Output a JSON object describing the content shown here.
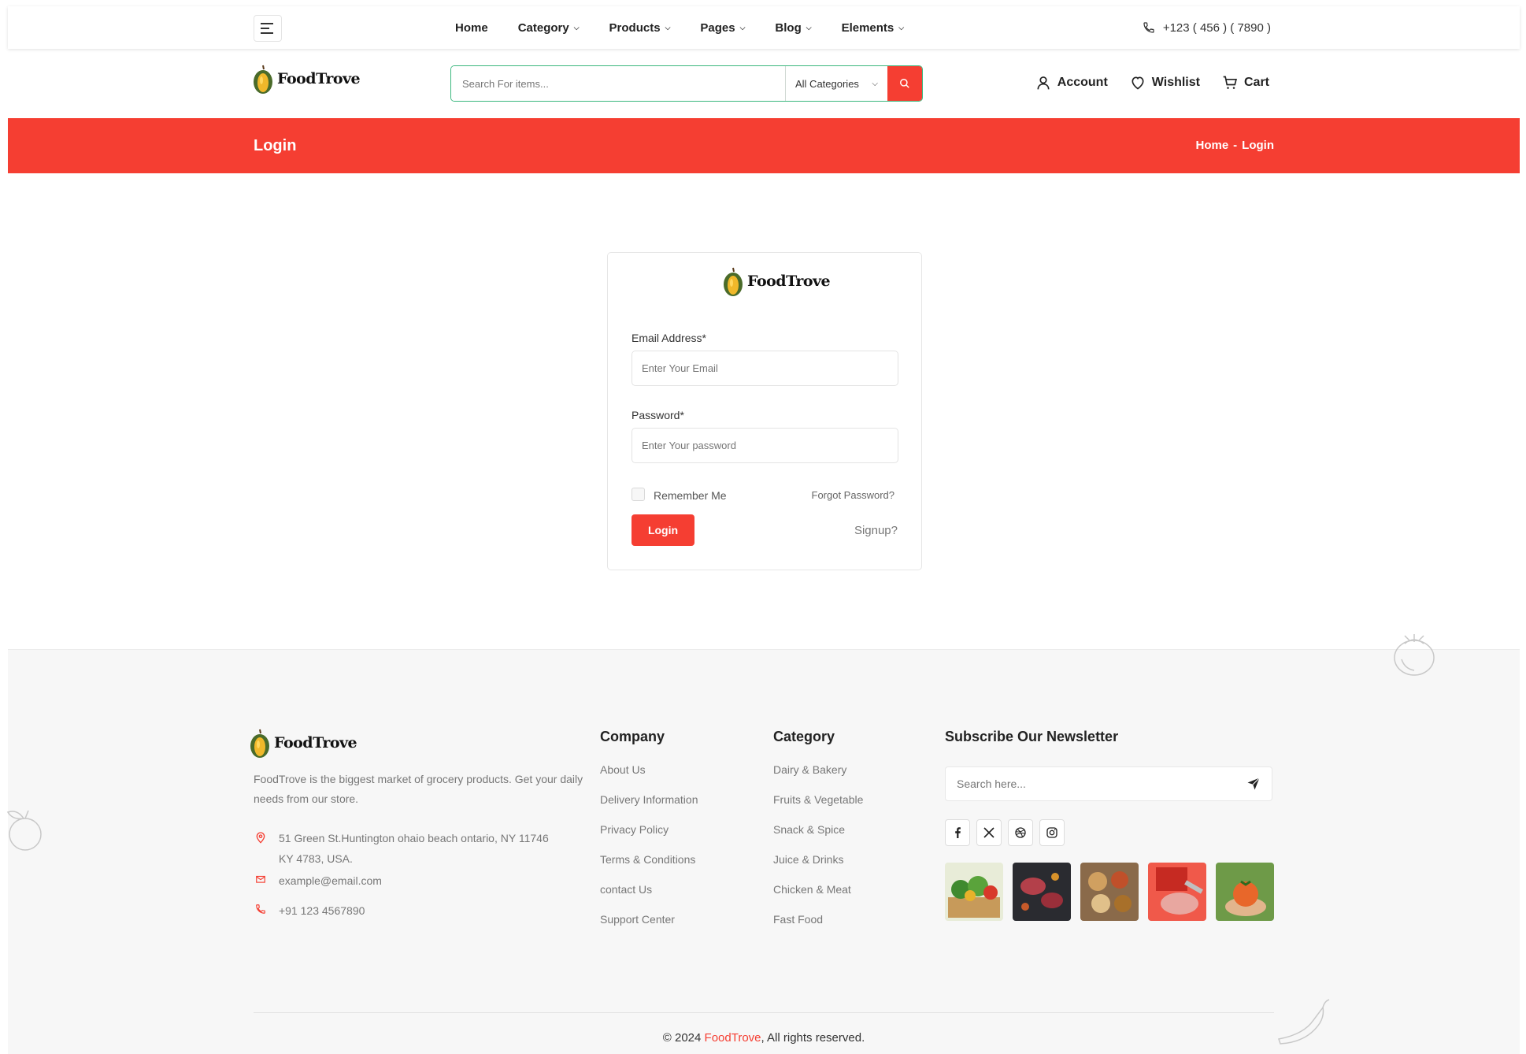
{
  "nav": {
    "links": [
      {
        "label": "Home",
        "dropdown": false
      },
      {
        "label": "Category",
        "dropdown": true
      },
      {
        "label": "Products",
        "dropdown": true
      },
      {
        "label": "Pages",
        "dropdown": true
      },
      {
        "label": "Blog",
        "dropdown": true
      },
      {
        "label": "Elements",
        "dropdown": true
      }
    ],
    "phone": "+123 ( 456 ) ( 7890 )"
  },
  "brand": {
    "name": "FoodTrove"
  },
  "search": {
    "placeholder": "Search For items...",
    "category": "All Categories"
  },
  "header_actions": {
    "account": "Account",
    "wishlist": "Wishlist",
    "cart": "Cart"
  },
  "banner": {
    "title": "Login",
    "breadcrumb_home": "Home",
    "breadcrumb_sep": "-",
    "breadcrumb_current": "Login"
  },
  "login": {
    "email_label": "Email Address*",
    "email_placeholder": "Enter Your Email",
    "password_label": "Password*",
    "password_placeholder": "Enter Your password",
    "remember_label": "Remember Me",
    "forgot_label": "Forgot Password?",
    "login_button": "Login",
    "signup_link": "Signup?"
  },
  "footer": {
    "description": "FoodTrove is the biggest market of grocery products. Get your daily needs from our store.",
    "address": "51 Green St.Huntington ohaio beach ontario, NY 11746 KY 4783, USA.",
    "email": "example@email.com",
    "phone": "+91 123 4567890",
    "company": {
      "title": "Company",
      "links": [
        "About Us",
        "Delivery Information",
        "Privacy Policy",
        "Terms & Conditions",
        "contact Us",
        "Support Center"
      ]
    },
    "category": {
      "title": "Category",
      "links": [
        "Dairy & Bakery",
        "Fruits & Vegetable",
        "Snack & Spice",
        "Juice & Drinks",
        "Chicken & Meat",
        "Fast Food"
      ]
    },
    "newsletter": {
      "title": "Subscribe Our Newsletter",
      "placeholder": "Search here..."
    },
    "social": [
      "facebook-icon",
      "x-icon",
      "dribbble-icon",
      "instagram-icon"
    ],
    "copyright_prefix": "© 2024",
    "copyright_brand": "FoodTrove",
    "copyright_suffix": ", All rights reserved."
  },
  "colors": {
    "accent": "#f53e32",
    "search_border": "#3bb77e",
    "footer_bg": "#f7f7f7"
  }
}
